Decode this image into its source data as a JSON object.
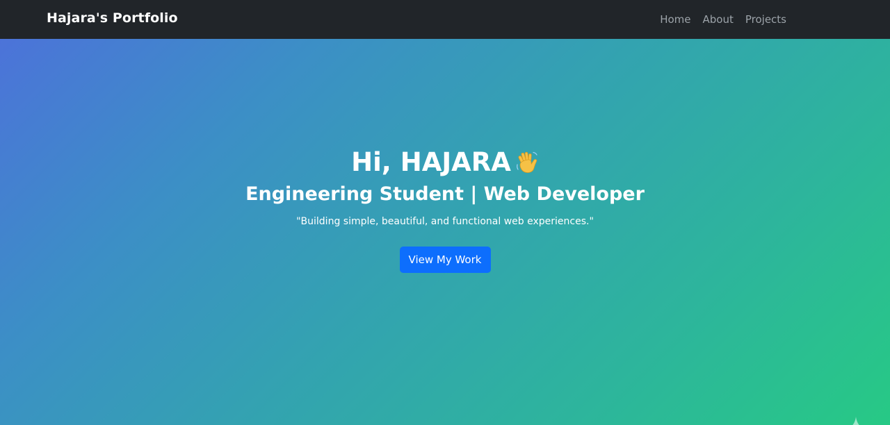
{
  "navbar": {
    "brand": "Hajara's Portfolio",
    "links": [
      "Home",
      "About",
      "Projects"
    ]
  },
  "hero": {
    "greeting": "Hi, HAJARA",
    "greeting_icon": "waving-hand-icon",
    "subtitle": "Engineering Student | Web Developer",
    "tagline": "\"Building simple, beautiful, and functional web experiences.\"",
    "cta_label": "View My Work"
  },
  "overlay_icon": "sparkle-icon",
  "colors": {
    "navbar_bg": "#212529",
    "gradient_start": "#4c73d9",
    "gradient_end": "#27c985",
    "button_primary": "#0d6efd",
    "nav_link": "#9ca3a9"
  }
}
